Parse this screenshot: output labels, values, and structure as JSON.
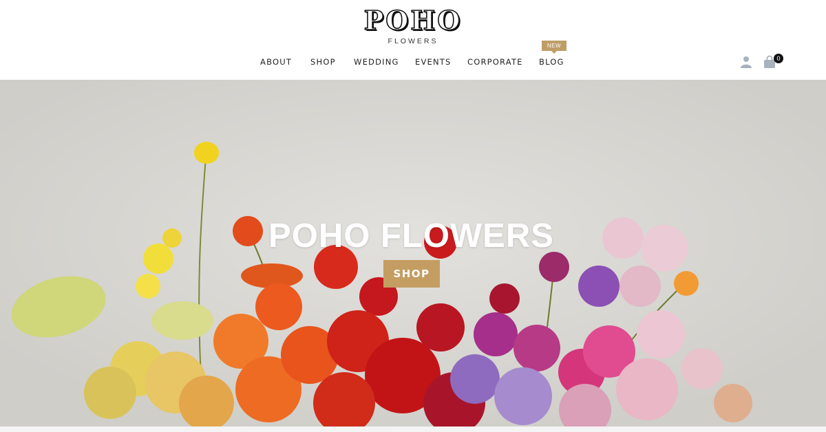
{
  "header": {
    "logo_main": "POHO",
    "logo_sub": "FLOWERS",
    "nav": [
      {
        "label": "ABOUT"
      },
      {
        "label": "SHOP"
      },
      {
        "label": "WEDDING"
      },
      {
        "label": "EVENTS"
      },
      {
        "label": "CORPORATE"
      },
      {
        "label": "BLOG"
      }
    ],
    "blog_badge": "NEW",
    "cart_count": "0",
    "icons": {
      "account": "user-icon",
      "cart": "shopping-bag-icon"
    }
  },
  "hero": {
    "title": "POHO FLOWERS",
    "button_label": "SHOP"
  },
  "colors": {
    "accent": "#c49d62",
    "hero_background": "#d9d8d4",
    "nav_text": "#222222"
  }
}
